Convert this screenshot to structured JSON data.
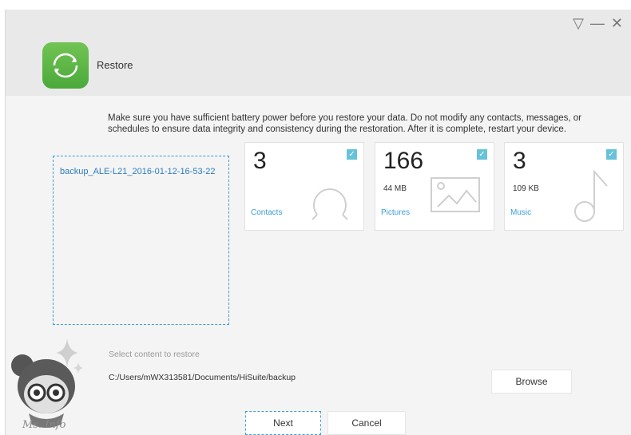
{
  "window": {
    "controls": {
      "minimize_tray": "▽",
      "minimize": "—",
      "close": "✕"
    }
  },
  "header": {
    "title": "Restore",
    "icon": "restore-icon",
    "accent": "#5cb85c"
  },
  "notice": "Make sure you have sufficient battery power before you restore your data. Do not modify any contacts, messages, or schedules to ensure data integrity and consistency during the restoration. After it is complete, restart your device.",
  "backups": [
    {
      "name": "backup_ALE-L21_2016-01-12-16-53-22"
    }
  ],
  "cards": [
    {
      "count": "3",
      "size": "",
      "label": "Contacts",
      "icon": "contact-icon",
      "checked": true
    },
    {
      "count": "166",
      "size": "44 MB",
      "label": "Pictures",
      "icon": "picture-icon",
      "checked": true
    },
    {
      "count": "3",
      "size": "109 KB",
      "label": "Music",
      "icon": "music-note-icon",
      "checked": true
    }
  ],
  "footer": {
    "section_label": "Select content to restore",
    "path": "C:/Users/mWX313581/Documents/HiSuite/backup",
    "browse_label": "Browse",
    "next_label": "Next",
    "cancel_label": "Cancel"
  },
  "watermark": "Ms. Info",
  "colors": {
    "link": "#2b7cc1",
    "accent_blue": "#3b9ed8",
    "check": "#66c2d9"
  }
}
